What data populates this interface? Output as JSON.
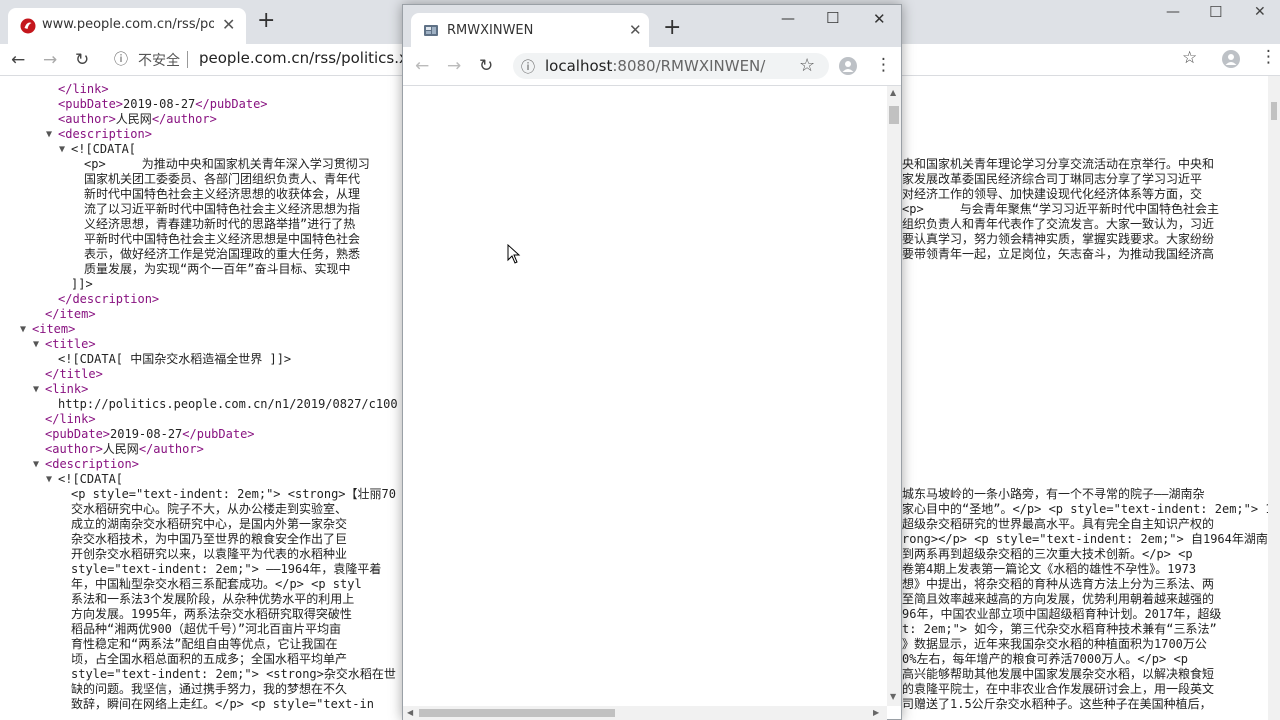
{
  "back_window": {
    "tab_title": "www.people.com.cn/rss/politic",
    "security_label": "不安全",
    "url": "people.com.cn/rss/politics.xml",
    "lines": [
      {
        "indent": 0,
        "tri": "",
        "html": "<span class=\"tag\">&lt;/link&gt;</span>"
      },
      {
        "indent": 0,
        "tri": "",
        "html": "<span class=\"tag\">&lt;pubDate&gt;</span>2019-08-27<span class=\"tag\">&lt;/pubDate&gt;</span>"
      },
      {
        "indent": 0,
        "tri": "",
        "html": "<span class=\"tag\">&lt;author&gt;</span>人民网<span class=\"tag\">&lt;/author&gt;</span>"
      },
      {
        "indent": 0,
        "tri": "▼",
        "html": "<span class=\"tag\">&lt;description&gt;</span>"
      },
      {
        "indent": 1,
        "tri": "▼",
        "html": "&lt;![CDATA["
      },
      {
        "indent": 2,
        "tri": "",
        "html": "&lt;p&gt;     为推动中央和国家机关青年深入学习贯彻习"
      },
      {
        "indent": 2,
        "tri": "",
        "html": "国家机关团工委委员、各部门团组织负责人、青年代"
      },
      {
        "indent": 2,
        "tri": "",
        "html": "新时代中国特色社会主义经济思想的收获体会，从理"
      },
      {
        "indent": 2,
        "tri": "",
        "html": "流了以习近平新时代中国特色社会主义经济思想为指"
      },
      {
        "indent": 2,
        "tri": "",
        "html": "义经济思想，青春建功新时代的思路举措”进行了热"
      },
      {
        "indent": 2,
        "tri": "",
        "html": "平新时代中国特色社会主义经济思想是中国特色社会"
      },
      {
        "indent": 2,
        "tri": "",
        "html": "表示，做好经济工作是党治国理政的重大任务，熟悉"
      },
      {
        "indent": 2,
        "tri": "",
        "html": "质量发展，为实现“两个一百年”奋斗目标、实现中"
      },
      {
        "indent": 1,
        "tri": "",
        "html": "]]&gt;"
      },
      {
        "indent": 0,
        "tri": "",
        "html": "<span class=\"tag\">&lt;/description&gt;</span>"
      },
      {
        "indent": -1,
        "tri": "",
        "html": "<span class=\"tag\">&lt;/item&gt;</span>"
      },
      {
        "indent": -2,
        "tri": "▼",
        "html": "<span class=\"tag\">&lt;item&gt;</span>"
      },
      {
        "indent": -1,
        "tri": "▼",
        "html": "<span class=\"tag\">&lt;title&gt;</span>"
      },
      {
        "indent": 0,
        "tri": "",
        "html": "&lt;![CDATA[ 中国杂交水稻造福全世界 ]]&gt;"
      },
      {
        "indent": -1,
        "tri": "",
        "html": "<span class=\"tag\">&lt;/title&gt;</span>"
      },
      {
        "indent": -1,
        "tri": "▼",
        "html": "<span class=\"tag\">&lt;link&gt;</span>"
      },
      {
        "indent": 0,
        "tri": "",
        "html": "http://politics.people.com.cn/n1/2019/0827/c100"
      },
      {
        "indent": -1,
        "tri": "",
        "html": "<span class=\"tag\">&lt;/link&gt;</span>"
      },
      {
        "indent": -1,
        "tri": "",
        "html": "<span class=\"tag\">&lt;pubDate&gt;</span>2019-08-27<span class=\"tag\">&lt;/pubDate&gt;</span>"
      },
      {
        "indent": -1,
        "tri": "",
        "html": "<span class=\"tag\">&lt;author&gt;</span>人民网<span class=\"tag\">&lt;/author&gt;</span>"
      },
      {
        "indent": -1,
        "tri": "▼",
        "html": "<span class=\"tag\">&lt;description&gt;</span>"
      },
      {
        "indent": 0,
        "tri": "▼",
        "html": "&lt;![CDATA["
      },
      {
        "indent": 1,
        "tri": "",
        "html": "&lt;p style=\"text-indent: 2em;\"&gt; &lt;strong&gt;【壮丽70"
      },
      {
        "indent": 1,
        "tri": "",
        "html": "交水稻研究中心。院子不大，从办公楼走到实验室、"
      },
      {
        "indent": 1,
        "tri": "",
        "html": "成立的湖南杂交水稻研究中心，是国内外第一家杂交"
      },
      {
        "indent": 1,
        "tri": "",
        "html": "杂交水稻技术，为中国乃至世界的粮食安全作出了巨"
      },
      {
        "indent": 1,
        "tri": "",
        "html": "开创杂交水稻研究以来，以袁隆平为代表的水稻种业"
      },
      {
        "indent": 1,
        "tri": "",
        "html": "style=\"text-indent: 2em;\"&gt; ——1964年，袁隆平着"
      },
      {
        "indent": 1,
        "tri": "",
        "html": "年，中国籼型杂交水稻三系配套成功。&lt;/p&gt; &lt;p styl"
      },
      {
        "indent": 1,
        "tri": "",
        "html": "系法和一系法3个发展阶段，从杂种优势水平的利用上"
      },
      {
        "indent": 1,
        "tri": "",
        "html": "方向发展。1995年，两系法杂交水稻研究取得突破性"
      },
      {
        "indent": 1,
        "tri": "",
        "html": "稻品种“湘两优900（超优千号）”河北百亩片平均亩"
      },
      {
        "indent": 1,
        "tri": "",
        "html": "育性稳定和“两系法”配组自由等优点，它让我国在"
      },
      {
        "indent": 1,
        "tri": "",
        "html": "顷，占全国水稻总面积的五成多；全国水稻平均单产"
      },
      {
        "indent": 1,
        "tri": "",
        "html": "style=\"text-indent: 2em;\"&gt; &lt;strong&gt;杂交水稻在世"
      },
      {
        "indent": 1,
        "tri": "",
        "html": "缺的问题。我坚信，通过携手努力，我的梦想在不久"
      },
      {
        "indent": 1,
        "tri": "",
        "html": "致辞，瞬间在网络上走红。&lt;/p&gt; &lt;p style=\"text-in"
      }
    ],
    "right_lines": [
      "央和国家机关青年理论学习分享交流活动在京举行。中央和",
      "家发展改革委国民经济综合司丁琳同志分享了学习习近平",
      "对经济工作的领导、加快建设现代化经济体系等方面，交",
      "<p>     与会青年聚焦“学习习近平新时代中国特色社会主",
      "组织负责人和青年代表作了交流发言。大家一致认为，习近",
      "要认真学习，努力领会精神实质，掌握实践要求。大家纷纷",
      "要带领青年一起，立足岗位，矢志奋斗，为推动我国经济高",
      "城东马坡岭的一条小路旁，有一个不寻常的院子——湖南杂",
      "家心目中的“圣地”。</p> <p style=\"text-indent: 2em;\"> 1984年",
      "超级杂交稻研究的世界最高水平。具有完全自主知识产权的",
      "rong></p> <p style=\"text-indent: 2em;\"> 自1964年湖南",
      "到两系再到超级杂交稻的三次重大技术创新。</p> <p",
      "卷第4期上发表第一篇论文《水稻的雄性不孕性》。1973",
      "想》中提出，将杂交稻的育种从选育方法上分为三系法、两",
      "至简且效率越来越高的方向发展，优势利用朝着越来越强的",
      "96年，中国农业部立项中国超级稻育种计划。2017年，超级",
      "t: 2em;\"> 如今，第三代杂交水稻育种技术兼有“三系法”",
      "》数据显示，近年来我国杂交水稻的种植面积为1700万公",
      "0%左右，每年增产的粮食可养活7000万人。</p> <p",
      "高兴能够帮助其他发展中国家发展杂交水稻，以解决粮食短",
      "的袁隆平院士，在中非农业合作发展研讨会上，用一段英文",
      "司赠送了1.5公斤杂交水稻种子。这些种子在美国种植后，"
    ]
  },
  "front_window": {
    "tab_title": "RMWXINWEN",
    "url_host": "localhost",
    "url_path": ":8080/RMWXINWEN/"
  }
}
